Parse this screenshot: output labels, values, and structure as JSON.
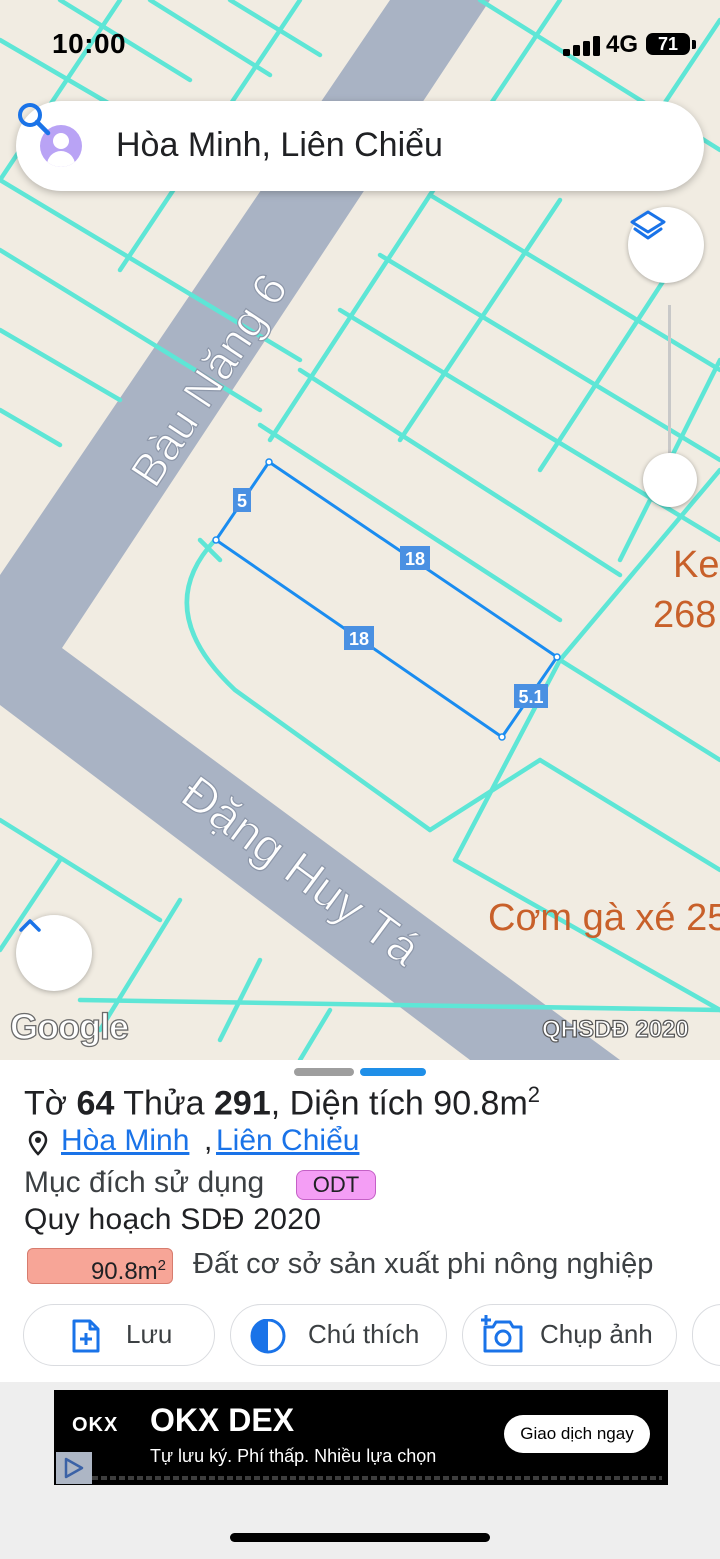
{
  "status_bar": {
    "time": "10:00",
    "network": "4G",
    "battery": "71"
  },
  "search": {
    "text": "Hòa Minh, Liên Chiểu"
  },
  "map": {
    "streets": [
      "Bàu Năng 6",
      "Đặng Huy Tá"
    ],
    "poi": [
      "Ke",
      "268",
      "Cơm gà xé 25"
    ],
    "parcel_dimensions": [
      "5",
      "18",
      "18",
      "5.1"
    ],
    "attribution": "Google",
    "layer_label": "QHSDĐ 2020",
    "colors": {
      "parcel_lines": "#5ee6d6",
      "selected_parcel": "#1a8cf0",
      "road": "#a9b3c4",
      "poi_text": "#c8602a"
    }
  },
  "parcel": {
    "prefix_sheet": "Tờ",
    "sheet": "64",
    "prefix_lot": "Thửa",
    "lot": "291",
    "area_label": ", Diện tích",
    "area": "90.8m",
    "area_unit_sup": "2",
    "ward": "Hòa Minh",
    "district": "Liên Chiểu",
    "separator": ",",
    "purpose_label": "Mục đích sử dụng",
    "purpose_code": "ODT",
    "plan_title": "Quy hoạch SDĐ 2020",
    "plan_area": "90.8m",
    "plan_area_sup": "2",
    "plan_land_type": "Đất cơ sở sản xuất phi nông nghiệp",
    "colors": {
      "odt": "#f49ef5",
      "plan": "#f7a597"
    }
  },
  "actions": [
    {
      "label": "Lưu",
      "icon": "add-document-icon"
    },
    {
      "label": "Chú thích",
      "icon": "legend-icon"
    },
    {
      "label": "Chụp ảnh",
      "icon": "camera-plus-icon"
    }
  ],
  "ad": {
    "logo": "OKX",
    "title": "OKX DEX",
    "subtitle": "Tự lưu ký. Phí thấp. Nhiều lựa chọn",
    "cta": "Giao dịch ngay"
  }
}
